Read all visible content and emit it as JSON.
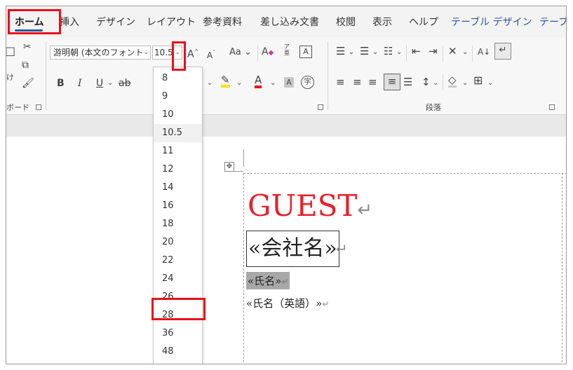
{
  "tabs": [
    {
      "label": "ホーム",
      "active": true
    },
    {
      "label": "挿入"
    },
    {
      "label": "デザイン"
    },
    {
      "label": "レイアウト"
    },
    {
      "label": "参考資料"
    },
    {
      "label": "差し込み文書"
    },
    {
      "label": "校閲"
    },
    {
      "label": "表示"
    },
    {
      "label": "ヘルプ"
    },
    {
      "label": "テーブル デザイン",
      "contextual": true
    },
    {
      "label": "テーブ",
      "contextual": true
    }
  ],
  "ribbon": {
    "clipboard_label": "ボード",
    "paste_partial": "け",
    "font_name": "游明朝 (本文のフォント",
    "font_size": "10.5",
    "grow_font": "A",
    "shrink_font": "A",
    "change_case": "Aa",
    "clear_format": "A",
    "phonetic_top": "ア",
    "phonetic_bottom": "亜",
    "char_border": "A",
    "bold": "B",
    "italic": "I",
    "underline": "U",
    "strike": "ab",
    "font_color": "A",
    "char_shading": "A",
    "enclose_char": "字",
    "sort": "A↓",
    "paragraph_label": "段落"
  },
  "font_size_options": [
    "8",
    "9",
    "10",
    "10.5",
    "11",
    "12",
    "14",
    "16",
    "18",
    "20",
    "22",
    "24",
    "26",
    "28",
    "36",
    "48"
  ],
  "selected_size": "10.5",
  "highlighted_size": "28",
  "document": {
    "guest": "GUEST",
    "company": "«会社名»",
    "name": "«氏名»",
    "name_en": "«氏名（英語）»",
    "return_mark": "↵"
  },
  "colors": {
    "highlight": "#e8101a",
    "guest_text": "#e8202a",
    "accent": "#2b5797"
  }
}
